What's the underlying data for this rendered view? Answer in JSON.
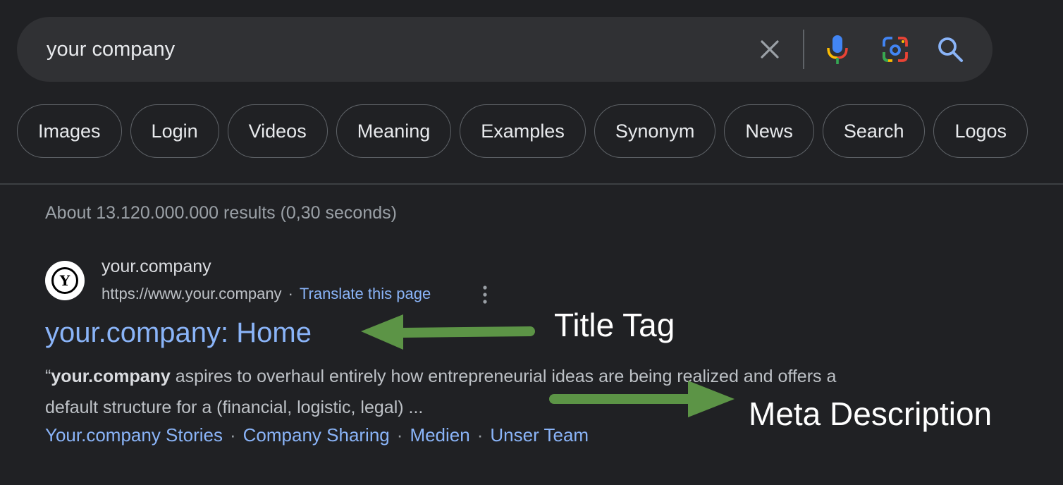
{
  "search": {
    "value": "your company",
    "clear_icon": "close-icon",
    "voice_icon": "microphone-icon",
    "lens_icon": "camera-lens-icon",
    "search_icon": "search-icon"
  },
  "chips": [
    "Images",
    "Login",
    "Videos",
    "Meaning",
    "Examples",
    "Synonym",
    "News",
    "Search",
    "Logos"
  ],
  "stats": "About 13.120.000.000 results (0,30 seconds)",
  "result": {
    "favicon_letter": "Y",
    "site_name": "your.company",
    "url": "https://www.your.company",
    "url_separator": "·",
    "translate": "Translate this page",
    "title": "your.company: Home",
    "snippet_open_quote": "“",
    "snippet_bold": "your.company",
    "snippet_rest": " aspires to overhaul entirely how entrepreneurial ideas are being realized and offers a default structure for a (financial, logistic, legal) ...",
    "sitelinks": [
      "Your.company Stories",
      "Company Sharing",
      "Medien",
      "Unser Team"
    ],
    "sitelink_separator": "·"
  },
  "annotations": {
    "title_tag": "Title Tag",
    "meta_description": "Meta Description",
    "arrow_color": "#5c9446"
  },
  "colors": {
    "background": "#202124",
    "link": "#8ab4f8",
    "arrow": "#5c9446"
  }
}
